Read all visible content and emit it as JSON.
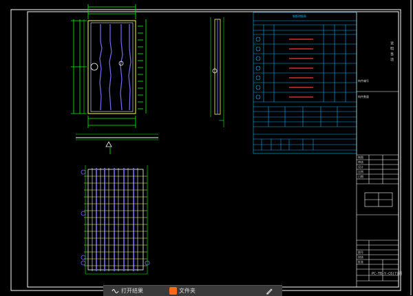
{
  "drawing": {
    "title_block": {
      "drawing_name": "PC-TB-Y-C6(7)图",
      "small_labels": [
        "制图",
        "审核",
        "设计",
        "比例",
        "日期",
        "图号",
        "校核",
        "批准"
      ]
    },
    "schedule_title": "钢筋明细表",
    "vertical_note": "说 明 事 项",
    "side_note_1": "构件编号",
    "side_note_2": "构件数量"
  },
  "taskbar": {
    "items": [
      {
        "icon": "audio-wave-icon",
        "label": "打开结果"
      },
      {
        "icon": "orange-app-icon",
        "label": "文件夹"
      },
      {
        "icon": "pen-edit-icon",
        "label": ""
      }
    ]
  },
  "colors": {
    "background": "#000000",
    "frame": "#ffffff",
    "table": "#00b4ff",
    "dimension": "#00ff00",
    "rebar": "#7a6cff",
    "hatch": "#ff3b3b",
    "outline_yellow": "#ffff55"
  }
}
